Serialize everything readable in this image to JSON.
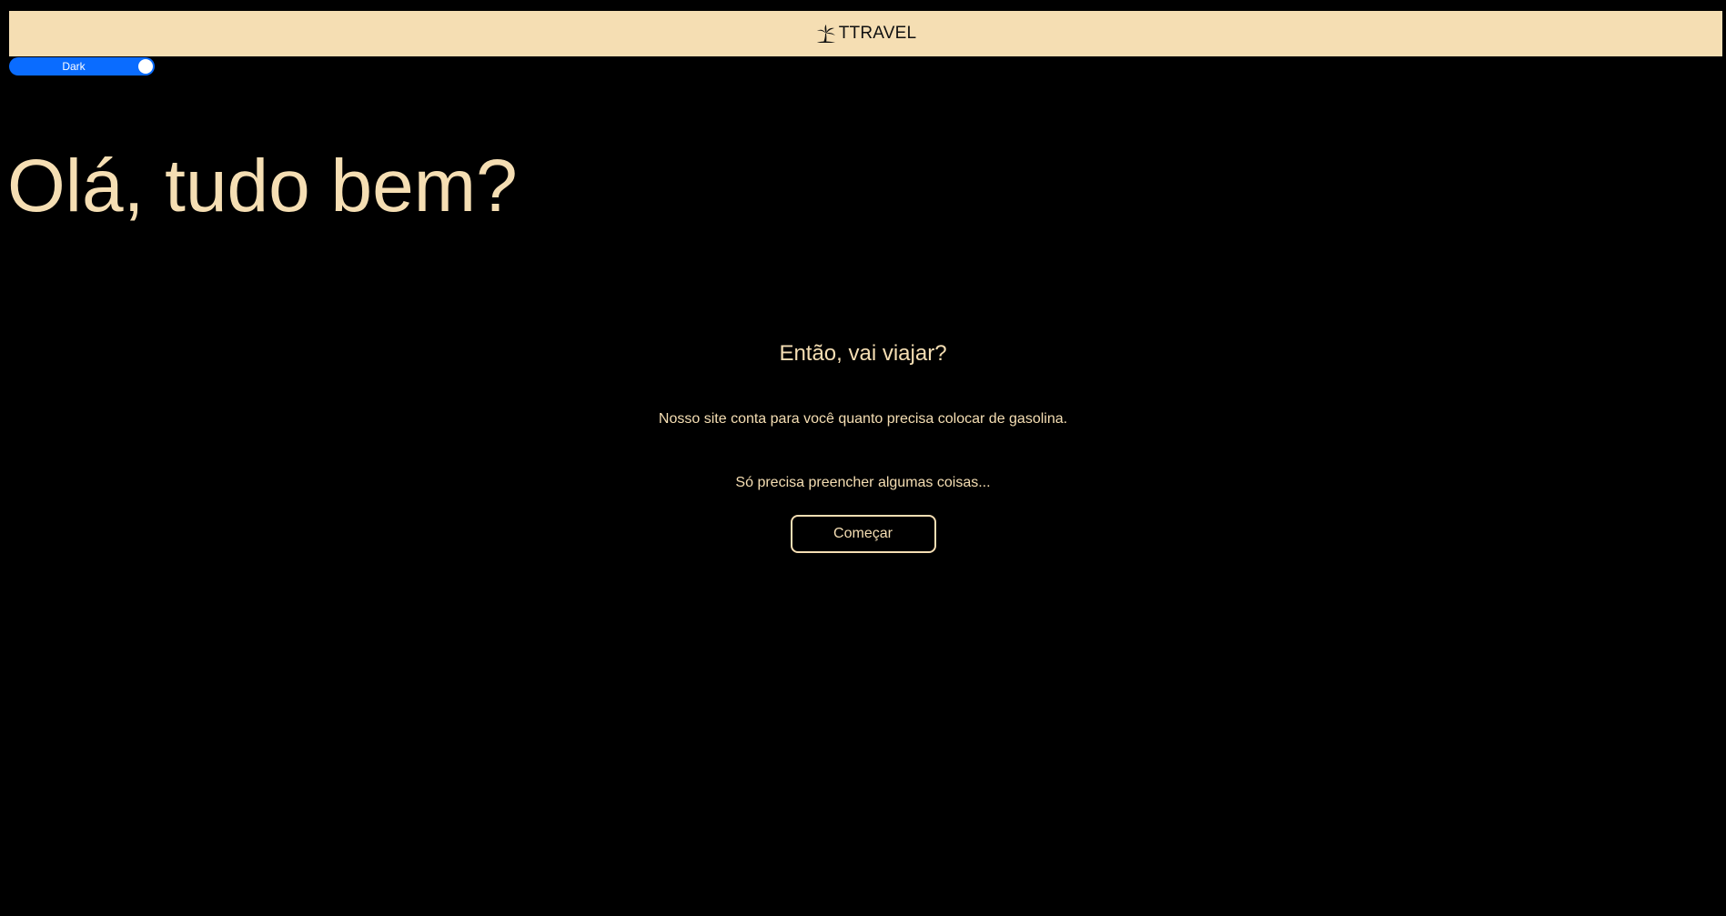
{
  "header": {
    "brand_text": "TTRAVEL",
    "brand_icon": "palm-island-icon"
  },
  "theme_toggle": {
    "label": "Dark",
    "state": "on",
    "accent_color": "#0a6cff"
  },
  "hero": {
    "greeting": "Olá, tudo bem?"
  },
  "intro": {
    "title": "Então, vai viajar?",
    "line1": "Nosso site conta para você quanto precisa colocar de gasolina.",
    "line2": "Só precisa preencher algumas coisas...",
    "start_label": "Começar"
  },
  "colors": {
    "background": "#000000",
    "accent_text": "#f5deb3",
    "header_bg": "#f5deb3"
  }
}
